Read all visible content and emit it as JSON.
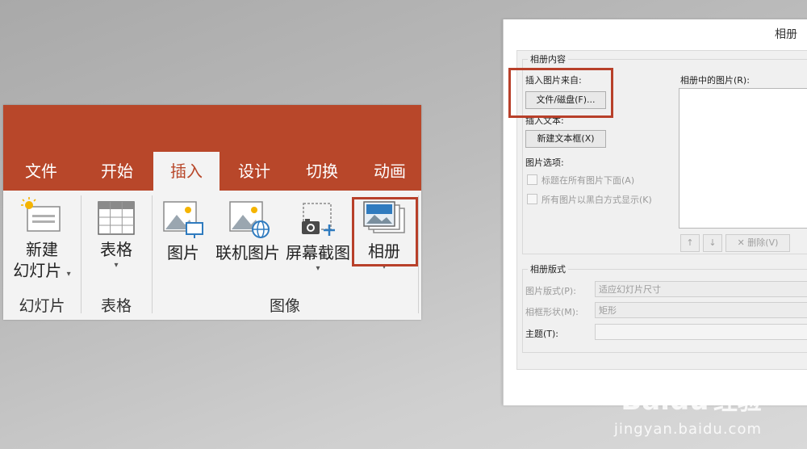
{
  "ribbon": {
    "tabs": [
      "文件",
      "开始",
      "插入",
      "设计",
      "切换",
      "动画"
    ],
    "active_tab_index": 2,
    "buttons": {
      "new_slide": {
        "line1": "新建",
        "line2": "幻灯片"
      },
      "table": "表格",
      "picture": "图片",
      "online_picture": "联机图片",
      "screenshot": "屏幕截图",
      "album": "相册"
    },
    "groups": {
      "slides": "幻灯片",
      "tables": "表格",
      "images": "图像"
    },
    "accent_color": "#b8472a"
  },
  "dialog": {
    "title": "相册",
    "album_content": {
      "legend": "相册内容",
      "insert_from_label": "插入图片来自:",
      "file_disk_button": "文件/磁盘(F)...",
      "insert_text_label": "插入文本:",
      "new_textbox_button": "新建文本框(X)",
      "picture_options_label": "图片选项:",
      "option_caption": "标题在所有图片下面(A)",
      "option_bw": "所有图片以黑白方式显示(K)",
      "pictures_in_album_label": "相册中的图片(R):",
      "up_arrow": "↑",
      "down_arrow": "↓",
      "remove_button": "删除(V)"
    },
    "album_layout": {
      "legend": "相册版式",
      "picture_layout_label": "图片版式(P):",
      "picture_layout_value": "适应幻灯片尺寸",
      "frame_shape_label": "相框形状(M):",
      "frame_shape_value": "矩形",
      "theme_label": "主题(T):",
      "theme_value": ""
    }
  },
  "watermark": {
    "brand": "Bai",
    "brand2": "du",
    "brand3": "经验",
    "url": "jingyan.baidu.com"
  }
}
